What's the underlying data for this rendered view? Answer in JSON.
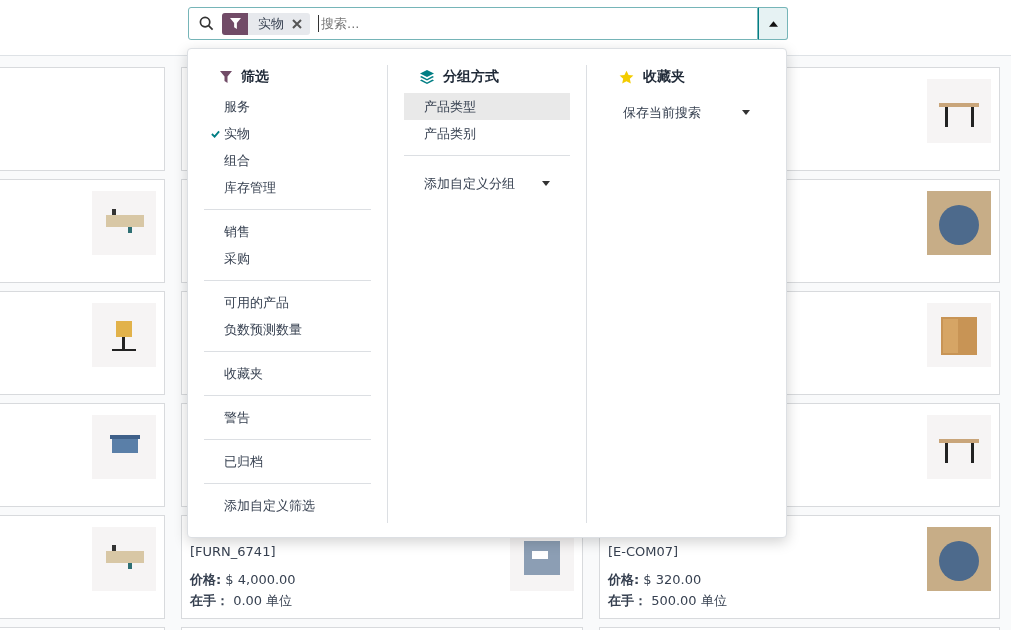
{
  "search": {
    "facets": [
      {
        "label": "实物"
      }
    ],
    "placeholder": "搜索..."
  },
  "dropdown": {
    "filters": {
      "title": "筛选",
      "groups": [
        [
          {
            "label": "服务",
            "checked": false
          },
          {
            "label": "实物",
            "checked": true
          },
          {
            "label": "组合",
            "checked": false
          },
          {
            "label": "库存管理",
            "checked": false
          }
        ],
        [
          {
            "label": "销售",
            "checked": false
          },
          {
            "label": "采购",
            "checked": false
          }
        ],
        [
          {
            "label": "可用的产品",
            "checked": false
          },
          {
            "label": "负数预测数量",
            "checked": false
          }
        ],
        [
          {
            "label": "收藏夹",
            "checked": false
          }
        ],
        [
          {
            "label": "警告",
            "checked": false
          }
        ],
        [
          {
            "label": "已归档",
            "checked": false
          }
        ],
        [
          {
            "label": "添加自定义筛选",
            "checked": false
          }
        ]
      ]
    },
    "group_by": {
      "title": "分组方式",
      "items": [
        {
          "label": "产品类型",
          "selected": true
        },
        {
          "label": "产品类别",
          "selected": false
        }
      ],
      "custom": "添加自定义分组"
    },
    "favorites": {
      "title": "收藏夹",
      "save": "保存当前搜索"
    }
  },
  "cards": [
    {
      "kind": "blank"
    },
    {
      "kind": "blank"
    },
    {
      "kind": "product"
    },
    {
      "kind": "product"
    },
    {
      "kind": "blank"
    },
    {
      "kind": "product"
    },
    {
      "kind": "product"
    },
    {
      "kind": "blank"
    },
    {
      "kind": "product"
    },
    {
      "kind": "product"
    },
    {
      "kind": "blank"
    },
    {
      "kind": "product"
    },
    {
      "kind": "product"
    },
    {
      "kind": "product",
      "code": "[FURN_6741]",
      "price": "**价格:** $ 4,000.00",
      "on_hand": "**在手：**  0.00 单位"
    },
    {
      "kind": "product",
      "code": "[E-COM07]",
      "price": "**价格:** $ 320.00",
      "on_hand": "**在手：**  500.00 单位"
    },
    {
      "kind": "blank"
    },
    {
      "kind": "blank"
    },
    {
      "kind": "blank"
    }
  ]
}
